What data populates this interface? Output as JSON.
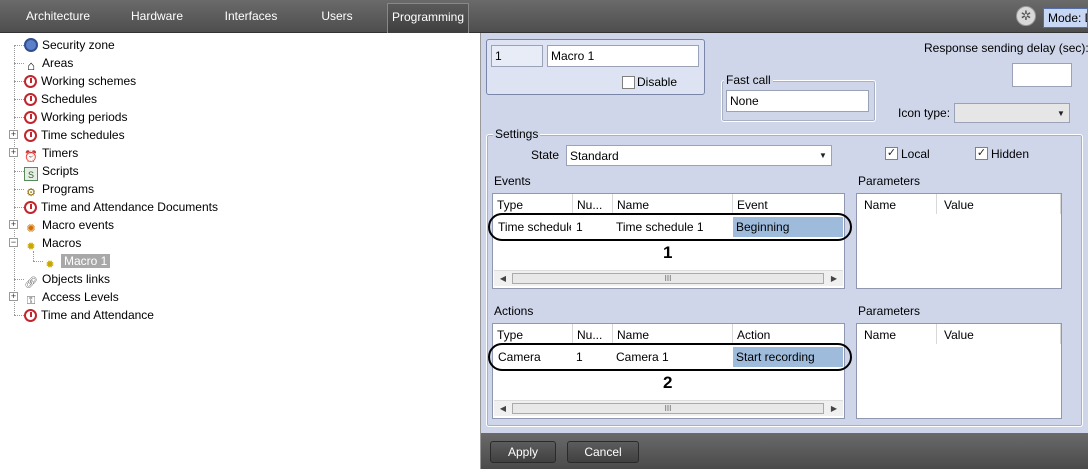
{
  "tabs": [
    {
      "label": "Architecture"
    },
    {
      "label": "Hardware"
    },
    {
      "label": "Interfaces"
    },
    {
      "label": "Users"
    },
    {
      "label": "Programming"
    }
  ],
  "mode_label": "Mode: D",
  "tree": {
    "items": [
      {
        "label": "Security zone",
        "icon": "security-zone-icon"
      },
      {
        "label": "Areas",
        "icon": "home-icon"
      },
      {
        "label": "Working schemes",
        "icon": "clock-icon"
      },
      {
        "label": "Schedules",
        "icon": "clock-icon"
      },
      {
        "label": "Working periods",
        "icon": "clock-icon"
      },
      {
        "label": "Time schedules",
        "icon": "clock-icon"
      },
      {
        "label": "Timers",
        "icon": "alarm-clock-icon"
      },
      {
        "label": "Scripts",
        "icon": "script-icon"
      },
      {
        "label": "Programs",
        "icon": "gears-icon"
      },
      {
        "label": "Time and Attendance Documents",
        "icon": "clock-icon"
      },
      {
        "label": "Macro events",
        "icon": "macro-event-icon"
      },
      {
        "label": "Macros",
        "icon": "macro-icon"
      },
      {
        "label": "Macro 1",
        "icon": "macro-icon"
      },
      {
        "label": "Objects links",
        "icon": "link-icon"
      },
      {
        "label": "Access Levels",
        "icon": "access-levels-icon"
      },
      {
        "label": "Time and Attendance",
        "icon": "clock-icon"
      }
    ]
  },
  "object": {
    "id": "1",
    "name": "Macro 1",
    "disable_label": "Disable"
  },
  "fast_call": {
    "label": "Fast call",
    "value": "None"
  },
  "response_delay": {
    "label": "Response sending delay (sec):",
    "value": ""
  },
  "icon_type": {
    "label": "Icon type:",
    "value": ""
  },
  "settings": {
    "label": "Settings",
    "state_label": "State",
    "state_value": "Standard",
    "local_label": "Local",
    "hidden_label": "Hidden"
  },
  "events": {
    "label": "Events",
    "columns": [
      "Type",
      "Nu...",
      "Name",
      "Event"
    ],
    "rows": [
      {
        "type": "Time schedule",
        "num": "1",
        "name": "Time schedule 1",
        "value": "Beginning"
      }
    ],
    "callout": "1"
  },
  "actions": {
    "label": "Actions",
    "columns": [
      "Type",
      "Nu...",
      "Name",
      "Action"
    ],
    "rows": [
      {
        "type": "Camera",
        "num": "1",
        "name": "Camera 1",
        "value": "Start recording"
      }
    ],
    "callout": "2"
  },
  "parameters": {
    "label": "Parameters",
    "columns": [
      "Name",
      "Value"
    ]
  },
  "scroll_thumb": "III",
  "buttons": {
    "apply": "Apply",
    "cancel": "Cancel"
  }
}
